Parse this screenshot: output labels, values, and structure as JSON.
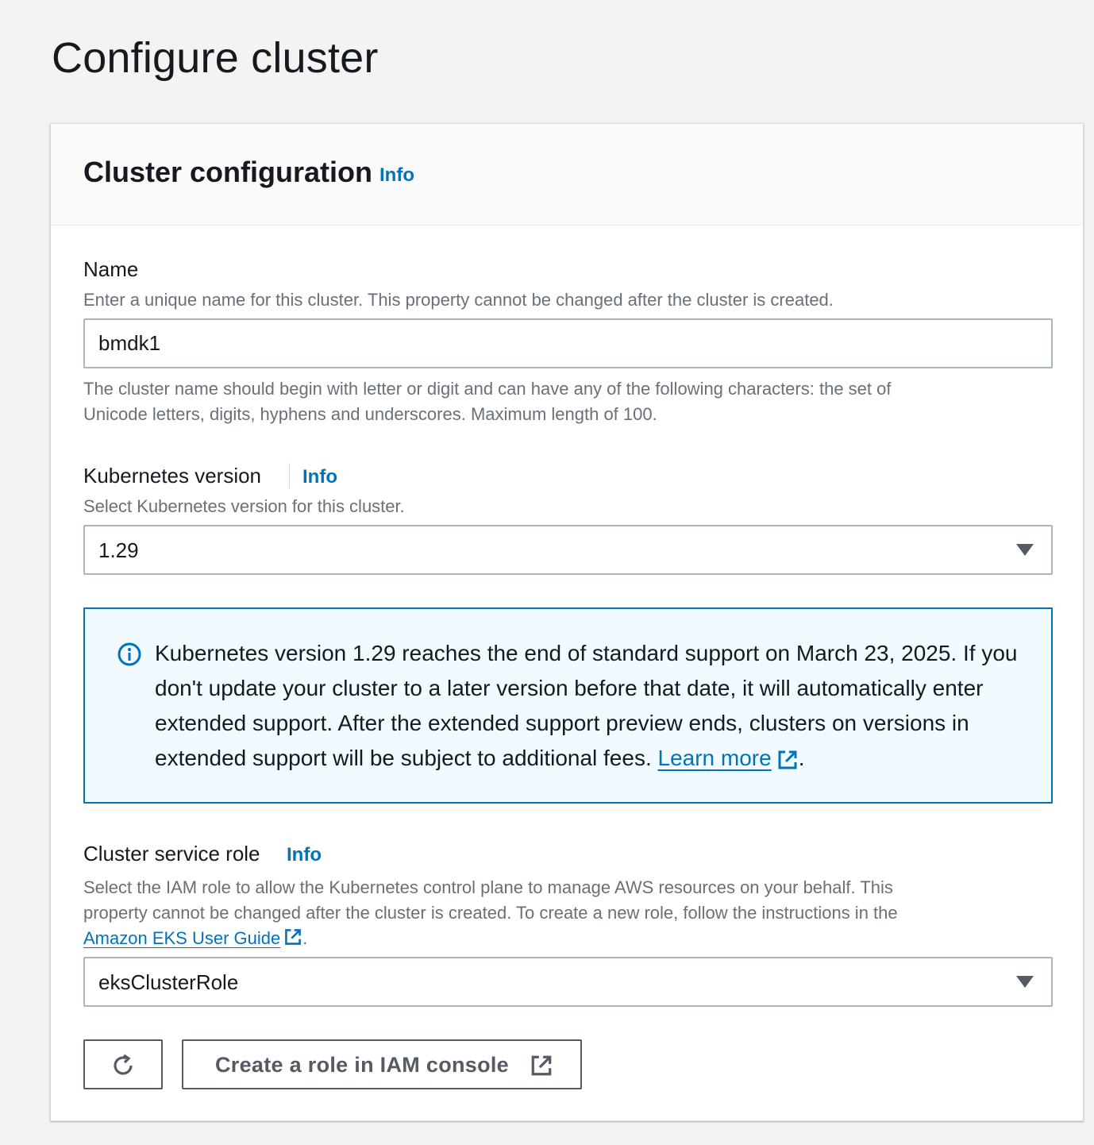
{
  "page": {
    "title": "Configure cluster"
  },
  "panel": {
    "title": "Cluster configuration",
    "info_label": "Info"
  },
  "name_field": {
    "label": "Name",
    "description": "Enter a unique name for this cluster. This property cannot be changed after the cluster is created.",
    "value": "bmdk1",
    "constraint_line1": "The cluster name should begin with letter or digit and can have any of the following characters: the set of",
    "constraint_line2": "Unicode letters, digits, hyphens and underscores. Maximum length of 100."
  },
  "version_field": {
    "label": "Kubernetes version",
    "info_label": "Info",
    "description": "Select Kubernetes version for this cluster.",
    "selected": "1.29"
  },
  "alert": {
    "icon": "info-circle-icon",
    "message": "Kubernetes version 1.29 reaches the end of standard support on March 23, 2025. If you don't update your cluster to a later version before that date, it will automatically enter extended support. After the extended support preview ends, clusters on versions in extended support will be subject to additional fees. ",
    "link_label": "Learn more",
    "trailing": ".",
    "color": "#0073bb",
    "background": "#f1faff"
  },
  "role_field": {
    "label": "Cluster service role",
    "info_label": "Info",
    "description_line1": "Select the IAM role to allow the Kubernetes control plane to manage AWS resources on your behalf. This",
    "description_line2": "property cannot be changed after the cluster is created. To create a new role, follow the instructions in the",
    "guide_link": "Amazon EKS User Guide",
    "trailing": ".",
    "selected": "eksClusterRole"
  },
  "buttons": {
    "refresh_icon": "refresh-icon",
    "create_role_label": "Create a role in IAM console",
    "external_icon": "external-link-icon"
  },
  "colors": {
    "link": "#0073bb",
    "text": "#16191f",
    "secondary_text": "#687078",
    "page_background": "#f2f3f3"
  }
}
